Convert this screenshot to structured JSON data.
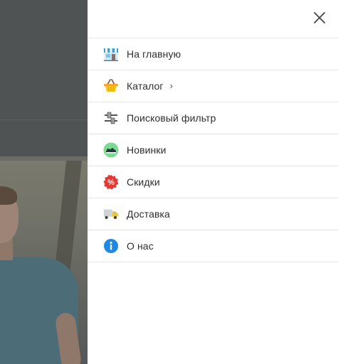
{
  "drawer": {
    "close_icon": "close-icon",
    "items": [
      {
        "label": "На главную",
        "icon": "storefront-icon"
      },
      {
        "label": "Каталог",
        "icon": "basket-icon",
        "chevron": "›"
      },
      {
        "label": "Поисковый фильтр",
        "icon": "sliders-icon"
      },
      {
        "label": "Новинки",
        "icon": "sneaker-icon"
      },
      {
        "label": "Скидки",
        "icon": "discount-badge-icon"
      },
      {
        "label": "Доставка",
        "icon": "delivery-truck-icon"
      },
      {
        "label": "О нас",
        "icon": "info-icon"
      }
    ]
  },
  "colors": {
    "overlay": "#505354",
    "drawer_bg": "#ffffff",
    "divider": "#e4e4e4",
    "text": "#2f2f2f",
    "info_blue": "#1e88e5",
    "discount_red": "#e53935",
    "new_green": "#7cd992",
    "basket_yellow": "#f5c518"
  }
}
